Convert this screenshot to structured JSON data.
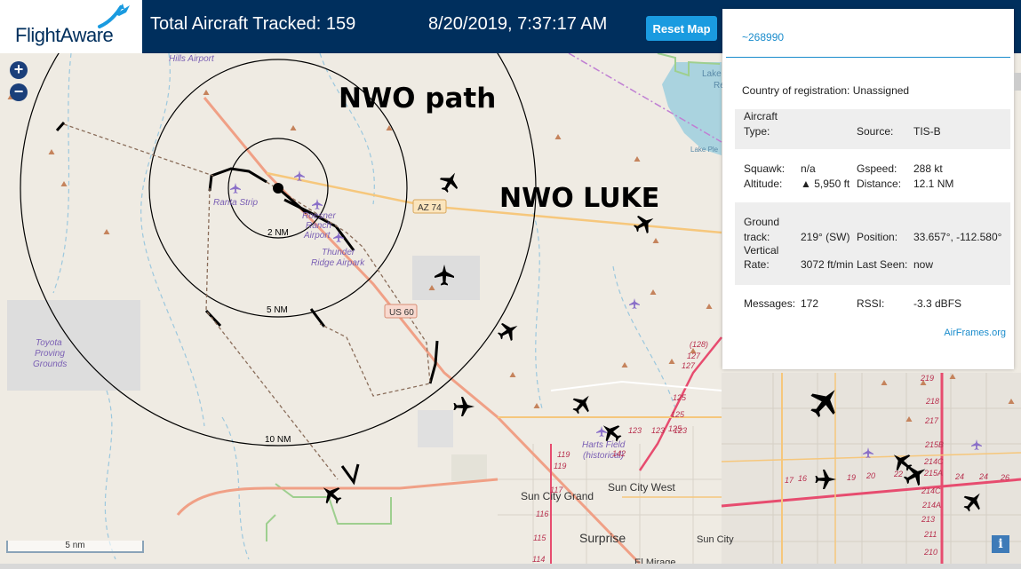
{
  "header": {
    "logo_text": "FlightAware",
    "total_tracked": "Total Aircraft Tracked: 159",
    "timestamp": "8/20/2019, 7:37:17 AM",
    "reset_label": "Reset Map"
  },
  "map_controls": {
    "zoom_in": "+",
    "zoom_out": "−",
    "scale": "5 nm",
    "info": "i"
  },
  "annotations": {
    "path": "NWO path",
    "luke": "NWO LUKE"
  },
  "map_labels": {
    "hills_airport": "Hills Airport",
    "ranta_strip": "Ranta Strip",
    "roesner1": "Roesner",
    "roesner2": "Ranch",
    "roesner3": "Airport",
    "thunder1": "Thunder",
    "thunder2": "Ridge Airpark",
    "toyota1": "Toyota",
    "toyota2": "Proving",
    "toyota3": "Grounds",
    "az74": "AZ 74",
    "us60": "US 60",
    "ring2": "2 NM",
    "ring5": "5 NM",
    "ring10": "10 NM",
    "lake1": "Lake",
    "lake2": "Re",
    "lake_ple": "Lake Ple",
    "harts1": "Harts Field",
    "harts2": "(historical)",
    "sun_city_grand": "Sun City Grand",
    "sun_city_west": "Sun City West",
    "surprise": "Surprise",
    "sun_city": "Sun City",
    "el_mirage": "El Mirage"
  },
  "road_numbers": [
    "(128)",
    "127",
    "127",
    "125",
    "125",
    "125",
    "123",
    "123",
    "123",
    "119",
    "119",
    "117",
    "116",
    "115",
    "114",
    "142",
    "17",
    "16",
    "19",
    "20",
    "22",
    "24",
    "24",
    "26",
    "219",
    "218",
    "217",
    "215B",
    "214C",
    "215A",
    "214C",
    "214A",
    "213",
    "211",
    "210"
  ],
  "panel": {
    "id": "~268990",
    "country_label": "Country of registration:",
    "country_value": "Unassigned",
    "aircraft_label": "Aircraft",
    "type_label": "Type:",
    "source_label": "Source:",
    "source_value": "TIS-B",
    "squawk_label": "Squawk:",
    "squawk_value": "n/a",
    "gspeed_label": "Gspeed:",
    "gspeed_value": "288 kt",
    "altitude_label": "Altitude:",
    "altitude_value": "▲ 5,950 ft",
    "distance_label": "Distance:",
    "distance_value": "12.1 NM",
    "ground_label": "Ground",
    "track_label": "track:",
    "track_value": "219° (SW)",
    "position_label": "Position:",
    "position_value": "33.657°, -112.580°",
    "vertical_label": "Vertical",
    "rate_label": "Rate:",
    "rate_value": "3072 ft/min",
    "lastseen_label": "Last Seen:",
    "lastseen_value": "now",
    "messages_label": "Messages:",
    "messages_value": "172",
    "rssi_label": "RSSI:",
    "rssi_value": "-3.3 dBFS",
    "airframes_link": "AirFrames.org"
  },
  "colors": {
    "header_bg": "#002f5d",
    "accent": "#1a9be0",
    "map_bg": "#efebe3"
  }
}
